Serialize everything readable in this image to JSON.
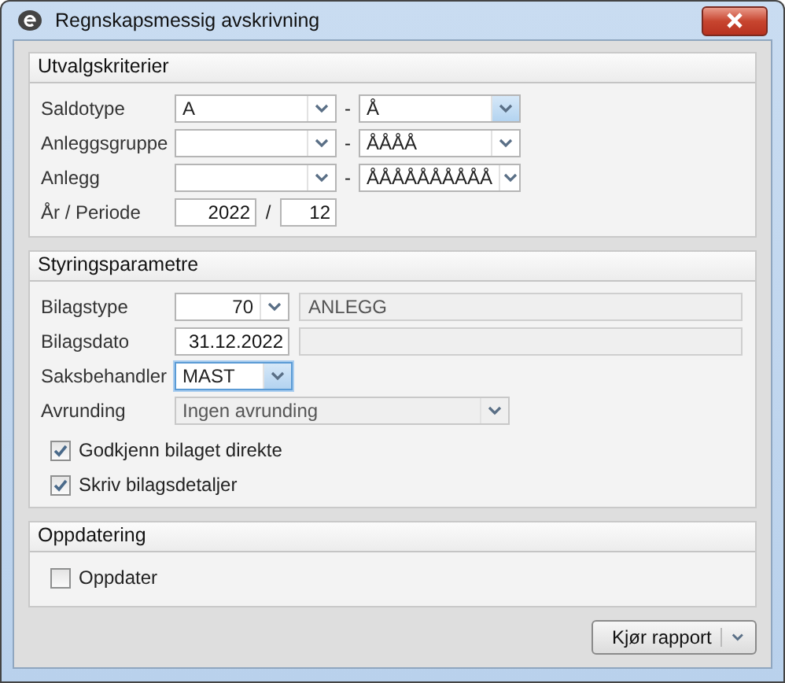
{
  "window": {
    "title": "Regnskapsmessig avskrivning"
  },
  "selection": {
    "title": "Utvalgskriterier",
    "ranges": [
      {
        "label": "Saldotype",
        "from": "A",
        "separator": "-",
        "to": "Å",
        "to_focused": true
      },
      {
        "label": "Anleggsgruppe",
        "separator": "-",
        "to": "ÅÅÅÅ",
        "to_focused": false
      },
      {
        "label": "Anlegg",
        "separator": "-",
        "to": "ÅÅÅÅÅÅÅÅÅÅ",
        "to_focused": false
      }
    ],
    "period": {
      "label": "År / Periode",
      "year": "2022",
      "separator": "/",
      "period": "12"
    }
  },
  "control": {
    "title": "Styringsparametre",
    "fields": [
      {
        "kind": "combo-display",
        "label": "Bilagstype",
        "value": "70",
        "display": "ANLEGG",
        "focused": false,
        "disabled": false
      },
      {
        "kind": "text-display",
        "label": "Bilagsdato",
        "value": "31.12.2022",
        "focused": false,
        "disabled": false
      },
      {
        "kind": "combo",
        "label": "Saksbehandler",
        "value": "MAST",
        "focused": true,
        "disabled": false
      },
      {
        "kind": "wide-combo",
        "label": "Avrunding",
        "value": "Ingen avrunding",
        "focused": false,
        "disabled": true
      }
    ],
    "checkboxes": [
      {
        "label": "Godkjenn bilaget direkte",
        "checked": true
      },
      {
        "label": "Skriv bilagsdetaljer",
        "checked": true
      }
    ]
  },
  "update": {
    "title": "Oppdatering",
    "checkboxes": [
      {
        "label": "Oppdater",
        "checked": false
      }
    ]
  },
  "run_button": {
    "label": "Kjør rapport"
  }
}
